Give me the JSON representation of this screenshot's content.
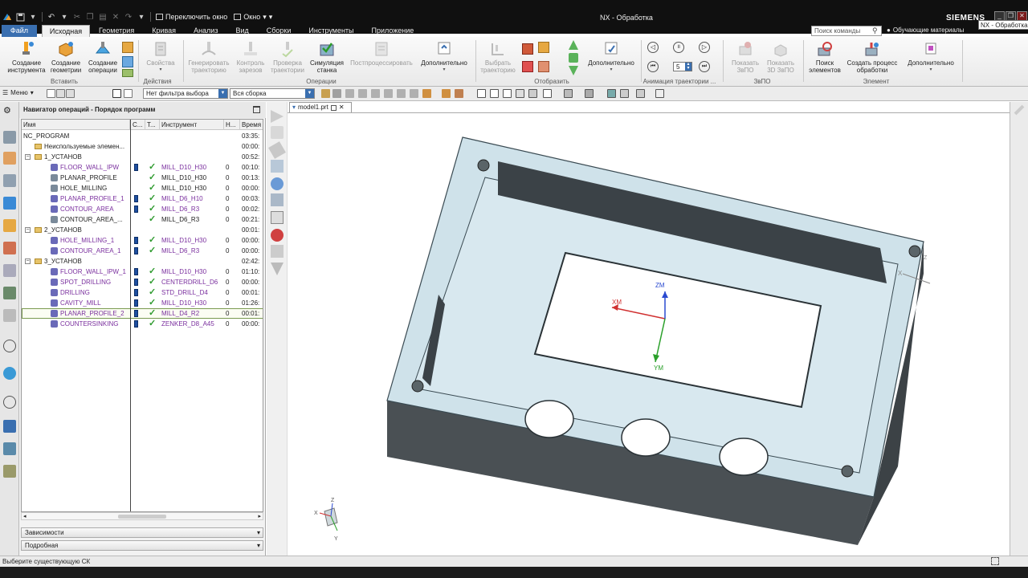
{
  "titlebar": {
    "switch_window": "Переключить окно",
    "window_menu": "Окно",
    "app_title": "NX - Обработка",
    "brand": "SIEMENS",
    "tooltip": "NX - Обработка"
  },
  "tabs": {
    "file": "Файл",
    "items": [
      "Исходная",
      "Геометрия",
      "Кривая",
      "Анализ",
      "Вид",
      "Сборки",
      "Инструменты",
      "Приложение"
    ],
    "active_index": 0
  },
  "command_search": {
    "placeholder": "Поиск команды"
  },
  "learning": "Обучающие материалы",
  "ribbon": {
    "insert_group": {
      "label": "Вставить",
      "create_tool": "Создание инструмента",
      "create_geometry": "Создание геометрии",
      "create_operation": "Создание операции"
    },
    "actions_group": {
      "label": "Действия",
      "properties": "Свойства"
    },
    "operations_group": {
      "label": "Операции",
      "generate_path": "Генерировать траекторию",
      "gouge_check": "Контроль зарезов",
      "verify_path": "Проверка траектории",
      "machine_sim": "Симуляция станка",
      "postprocess": "Постпроцессировать",
      "more": "Дополнительно"
    },
    "display_group": {
      "label": "Отобразить",
      "select_path": "Выбрать траекторию",
      "more": "Дополнительно"
    },
    "animation_group": {
      "label": "Анимация траектории ...",
      "speed_value": "5"
    },
    "ipw_group": {
      "label": "ЗвПО",
      "show_ipw": "Показать ЗвПО",
      "show_3d_ipw": "Показать 3D ЗвПО"
    },
    "feature_group": {
      "label": "Элемент",
      "find_features": "Поиск элементов",
      "create_process": "Создать процесс обработки",
      "more": "Дополнительно"
    }
  },
  "toolbar2": {
    "menu": "Меню",
    "filter": "Нет фильтра выбора",
    "assembly": "Вся сборка"
  },
  "navigator": {
    "title": "Навигатор операций - Порядок программ",
    "columns": [
      "Имя",
      "С...",
      "Т...",
      "Инструмент",
      "Н...",
      "Время"
    ],
    "rows": [
      {
        "name": "NC_PROGRAM",
        "level": 0,
        "kind": "root",
        "tool": "",
        "num": "",
        "time": "03:35:"
      },
      {
        "name": "Неиспользуемые элемен...",
        "level": 1,
        "kind": "folder",
        "tool": "",
        "num": "",
        "time": "00:00:"
      },
      {
        "name": "1_УСТАНОВ",
        "level": 1,
        "kind": "group",
        "tool": "",
        "num": "",
        "time": "00:52:"
      },
      {
        "name": "FLOOR_WALL_IPW",
        "level": 2,
        "kind": "op",
        "purple": true,
        "tl": true,
        "tool": "MILL_D10_H30",
        "num": "0",
        "time": "00:10:"
      },
      {
        "name": "PLANAR_PROFILE",
        "level": 2,
        "kind": "op",
        "purple": false,
        "tl": false,
        "tool": "MILL_D10_H30",
        "num": "0",
        "time": "00:13:"
      },
      {
        "name": "HOLE_MILLING",
        "level": 2,
        "kind": "op",
        "purple": false,
        "tl": false,
        "tool": "MILL_D10_H30",
        "num": "0",
        "time": "00:00:"
      },
      {
        "name": "PLANAR_PROFILE_1",
        "level": 2,
        "kind": "op",
        "purple": true,
        "tl": true,
        "tool": "MILL_D6_H10",
        "num": "0",
        "time": "00:03:"
      },
      {
        "name": "CONTOUR_AREA",
        "level": 2,
        "kind": "op",
        "purple": true,
        "tl": true,
        "tool": "MILL_D6_R3",
        "num": "0",
        "time": "00:02:"
      },
      {
        "name": "CONTOUR_AREA_...",
        "level": 2,
        "kind": "op",
        "purple": false,
        "tl": false,
        "tool": "MILL_D6_R3",
        "num": "0",
        "time": "00:21:"
      },
      {
        "name": "2_УСТАНОВ",
        "level": 1,
        "kind": "group",
        "tool": "",
        "num": "",
        "time": "00:01:"
      },
      {
        "name": "HOLE_MILLING_1",
        "level": 2,
        "kind": "op",
        "purple": true,
        "tl": true,
        "tool": "MILL_D10_H30",
        "num": "0",
        "time": "00:00:"
      },
      {
        "name": "CONTOUR_AREA_1",
        "level": 2,
        "kind": "op",
        "purple": true,
        "tl": true,
        "tool": "MILL_D6_R3",
        "num": "0",
        "time": "00:00:"
      },
      {
        "name": "3_УСТАНОВ",
        "level": 1,
        "kind": "group",
        "tool": "",
        "num": "",
        "time": "02:42:"
      },
      {
        "name": "FLOOR_WALL_IPW_1",
        "level": 2,
        "kind": "op",
        "purple": true,
        "tl": true,
        "tool": "MILL_D10_H30",
        "num": "0",
        "time": "01:10:"
      },
      {
        "name": "SPOT_DRILLING",
        "level": 2,
        "kind": "op",
        "purple": true,
        "tl": true,
        "tool": "CENTERDRILL_D6",
        "num": "0",
        "time": "00:00:"
      },
      {
        "name": "DRILLING",
        "level": 2,
        "kind": "op",
        "purple": true,
        "tl": true,
        "tool": "STD_DRILL_D4",
        "num": "0",
        "time": "00:01:"
      },
      {
        "name": "CAVITY_MILL",
        "level": 2,
        "kind": "op",
        "purple": true,
        "tl": true,
        "tool": "MILL_D10_H30",
        "num": "0",
        "time": "01:26:"
      },
      {
        "name": "PLANAR_PROFILE_2",
        "level": 2,
        "kind": "op",
        "purple": true,
        "tl": true,
        "tool": "MILL_D4_R2",
        "num": "0",
        "time": "00:01:",
        "highlight": true
      },
      {
        "name": "COUNTERSINKING",
        "level": 2,
        "kind": "op",
        "purple": true,
        "tl": true,
        "tool": "ZENKER_D8_A45",
        "num": "0",
        "time": "00:00:"
      }
    ],
    "panels": [
      "Зависимости",
      "Подробная"
    ]
  },
  "graphics": {
    "file_tab": "model1.prt",
    "axis_x": "XM",
    "axis_y": "YM",
    "axis_z": "ZM",
    "triad_x": "X",
    "triad_y": "Y",
    "triad_z": "Z",
    "mcs_x": "X",
    "mcs_z": "Z",
    "part_color": "#cfe2ea",
    "part_side_color": "#4a5054"
  },
  "status": {
    "message": "Выберите существующую СК"
  }
}
